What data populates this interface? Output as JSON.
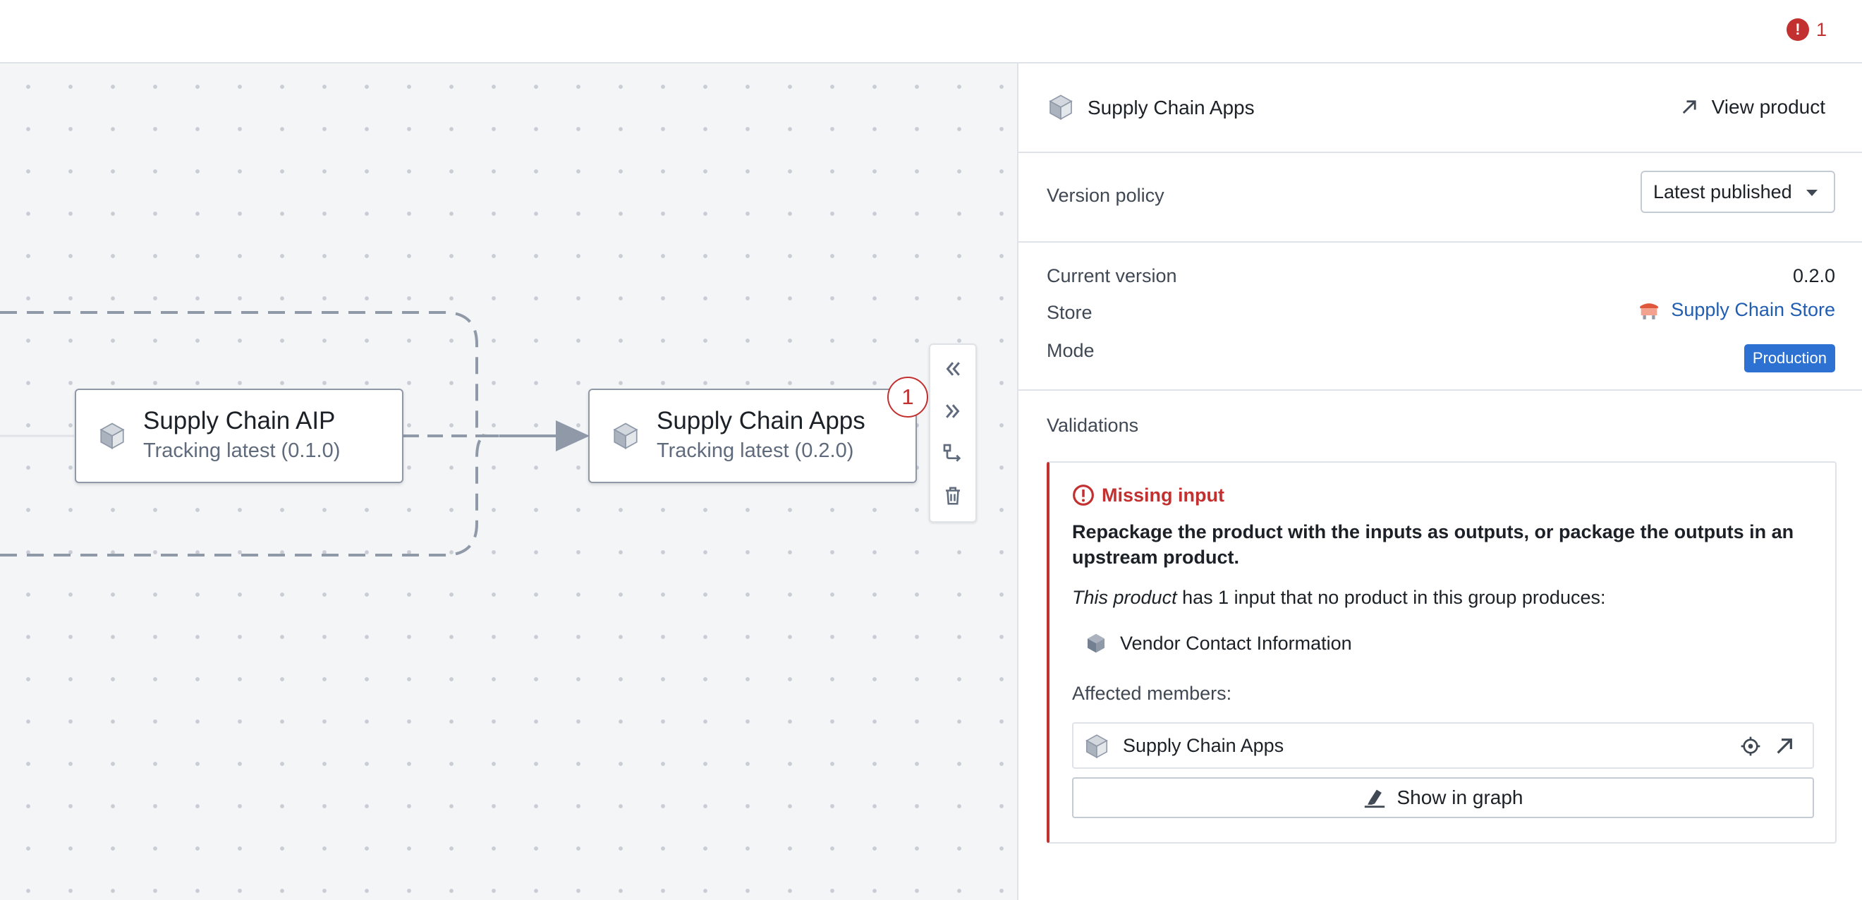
{
  "header": {
    "error_count": "1",
    "error_icon": "error-circle-icon"
  },
  "graph": {
    "nodes": [
      {
        "title": "Supply Chain AIP",
        "subtitle": "Tracking latest (0.1.0)",
        "icon": "package-cube-icon"
      },
      {
        "title": "Supply Chain Apps",
        "subtitle": "Tracking latest (0.2.0)",
        "icon": "package-cube-icon",
        "badge": "1"
      }
    ],
    "toolbar": [
      "collapse-upstream-icon",
      "expand-downstream-icon",
      "route-icon",
      "trash-icon"
    ]
  },
  "panel": {
    "product_name": "Supply Chain Apps",
    "view_product": "View product",
    "version_policy_label": "Version policy",
    "version_policy_value": "Latest published",
    "current_version_label": "Current version",
    "current_version_value": "0.2.0",
    "store_label": "Store",
    "store_value": "Supply Chain Store",
    "mode_label": "Mode",
    "mode_value": "Production",
    "validations_label": "Validations",
    "validation": {
      "title": "Missing input",
      "message": "Repackage the product with the inputs as outputs, or package the outputs in an upstream product.",
      "detail_em": "This product",
      "detail_rest": " has 1 input that no product in this group produces:",
      "missing_item": "Vendor Contact Information",
      "affected_label": "Affected members:",
      "member": "Supply Chain Apps",
      "show_in_graph": "Show in graph"
    }
  },
  "colors": {
    "error": "#c23030",
    "link": "#215db0",
    "production": "#2d72d2",
    "store_icon": "#e0583b"
  }
}
